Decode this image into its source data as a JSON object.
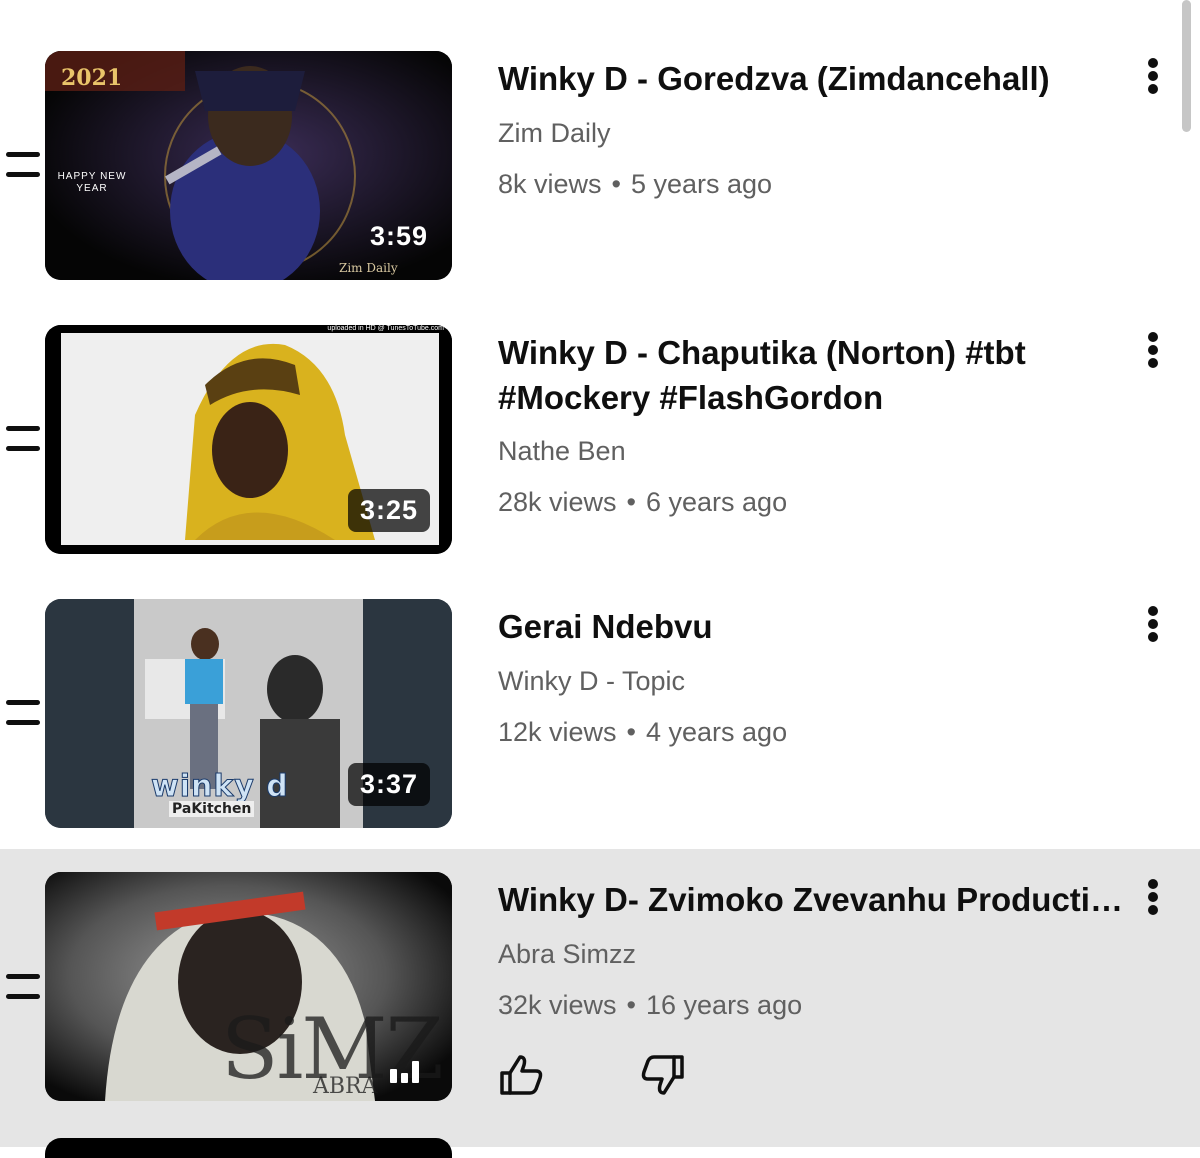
{
  "videos": [
    {
      "title": "Winky D - Goredzva (Zimdancehall)",
      "channel": "Zim Daily",
      "views": "8k views",
      "age": "5 years ago",
      "duration": "3:59",
      "thumb_text": {
        "year": "2021",
        "greeting_line1": "HAPPY NEW",
        "greeting_line2": "YEAR",
        "watermark": "Zim Daily"
      }
    },
    {
      "title": "Winky D - Chaputika (Norton) #tbt #Mockery #FlashGordon",
      "channel": "Nathe Ben",
      "views": "28k views",
      "age": "6 years ago",
      "duration": "3:25",
      "thumb_text": {
        "watermark": "uploaded in HD @ TunesToTube.com"
      }
    },
    {
      "title": "Gerai Ndebvu",
      "channel": "Winky D - Topic",
      "views": "12k views",
      "age": "4 years ago",
      "duration": "3:37",
      "thumb_text": {
        "logo": "winky d",
        "subtitle": "PaKitchen"
      }
    },
    {
      "title": "Winky D- Zvimoko Zvevanhu Productions",
      "channel": "Abra Simzz",
      "views": "32k views",
      "age": "16 years ago",
      "duration": "",
      "playing_indicator": "equalizer-icon",
      "thumb_text": {
        "logo": "SiMZ",
        "logo2": "ABRA"
      }
    }
  ],
  "separator": "•",
  "actions": {
    "like": "thumbs-up-icon",
    "dislike": "thumbs-down-icon"
  },
  "colors": {
    "active_row": "#e5e5e5",
    "secondary_text": "#606060",
    "primary_text": "#0f0f0f"
  }
}
